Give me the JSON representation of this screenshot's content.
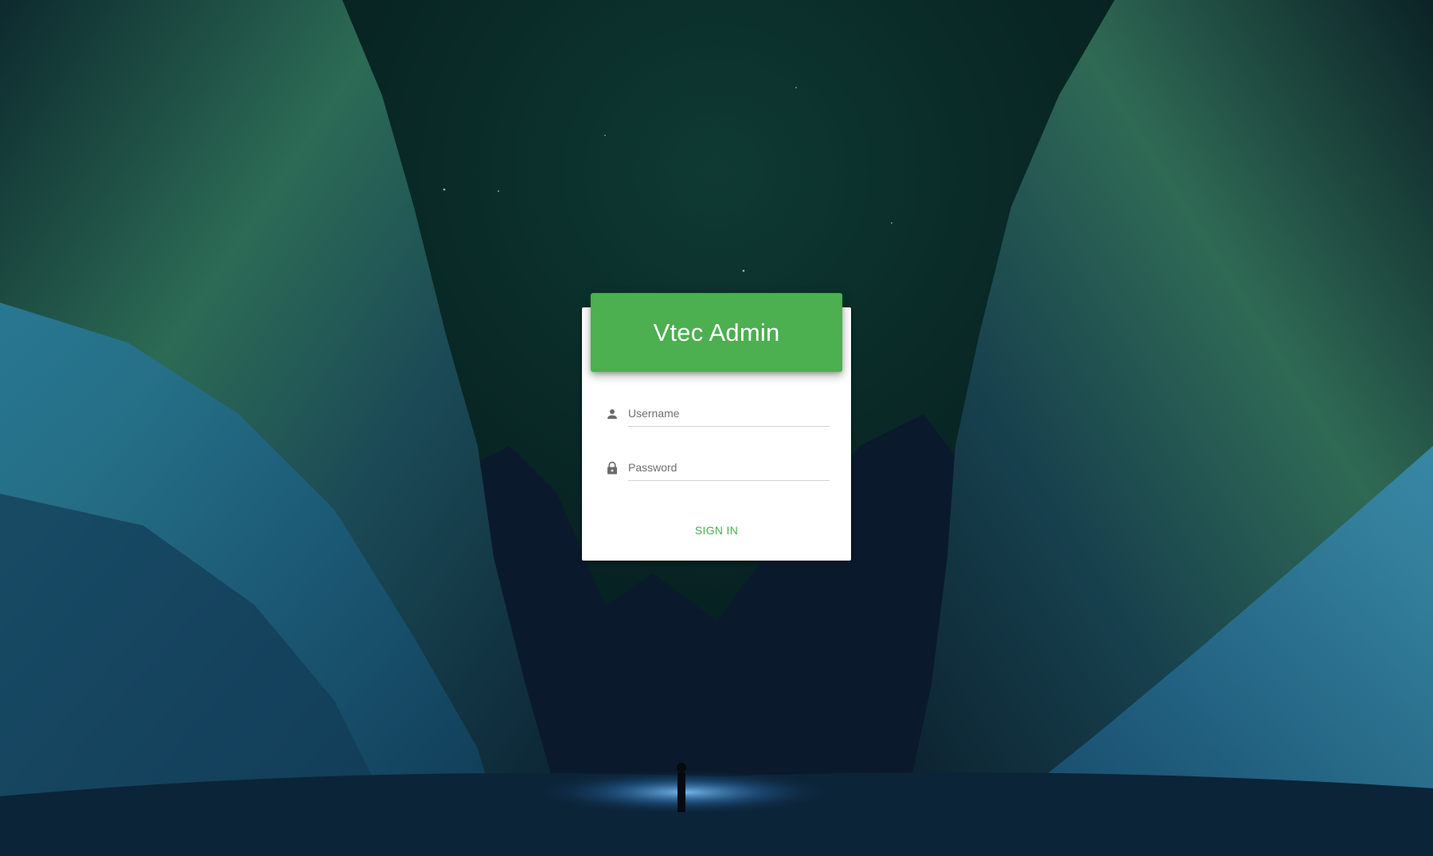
{
  "login": {
    "title": "Vtec Admin",
    "username": {
      "placeholder": "Username",
      "value": "",
      "icon": "person-icon"
    },
    "password": {
      "placeholder": "Password",
      "value": "",
      "icon": "lock-icon"
    },
    "submit_label": "SIGN IN"
  },
  "colors": {
    "accent": "#4caf50",
    "card_background": "#ffffff",
    "icon": "#6b6b6b"
  }
}
